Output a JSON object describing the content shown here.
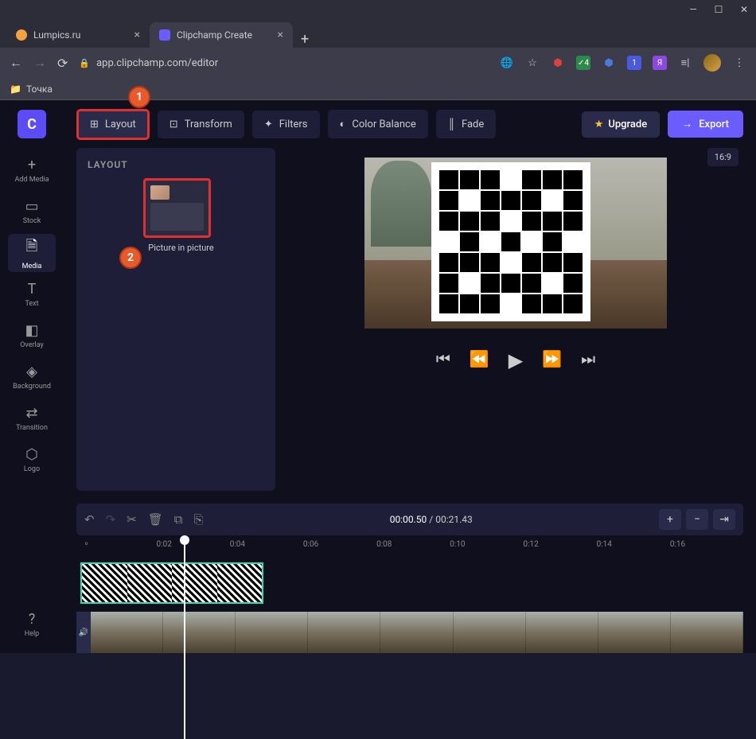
{
  "window": {
    "minimize": "—",
    "maximize": "☐",
    "close": "✕"
  },
  "tabs": [
    {
      "title": "Lumpics.ru",
      "favicon_color": "#f4a142"
    },
    {
      "title": "Clipchamp Create",
      "favicon_color": "#6b5cff",
      "active": true
    }
  ],
  "browser": {
    "url": "app.clipchamp.com/editor",
    "bookmark": "Точка"
  },
  "sidebar": {
    "logo": "C",
    "items": [
      {
        "icon": "+",
        "label": "Add Media"
      },
      {
        "icon": "▭",
        "label": "Stock"
      },
      {
        "icon": "🗎",
        "label": "Media",
        "active": true
      },
      {
        "icon": "T",
        "label": "Text"
      },
      {
        "icon": "◧",
        "label": "Overlay"
      },
      {
        "icon": "◈",
        "label": "Background"
      },
      {
        "icon": "⇄",
        "label": "Transition"
      },
      {
        "icon": "⬡",
        "label": "Logo"
      }
    ],
    "help": {
      "icon": "?",
      "label": "Help"
    }
  },
  "toolbar": {
    "layout": "Layout",
    "transform": "Transform",
    "filters": "Filters",
    "color_balance": "Color Balance",
    "fade": "Fade",
    "upgrade": "Upgrade",
    "export": "Export"
  },
  "panel": {
    "title": "LAYOUT",
    "pip_label": "Picture in picture"
  },
  "markers": {
    "m1": "1",
    "m2": "2"
  },
  "preview": {
    "ratio": "16:9"
  },
  "playback": {
    "current": "00:00.50",
    "total": "00:21.43"
  },
  "ruler": [
    "0:02",
    "0:04",
    "0:06",
    "0:08",
    "0:10",
    "0:12",
    "0:14",
    "0:16"
  ]
}
